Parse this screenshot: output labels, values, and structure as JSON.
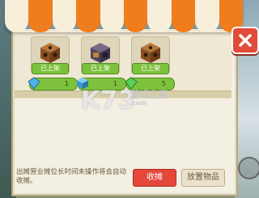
{
  "colors": {
    "awning_orange": "#f07d1c",
    "awning_cream": "#f7efd9",
    "panel": "#f3efe2",
    "badge_green": "#7cc13b",
    "collect_red": "#e5473b",
    "close_red": "#e24a3a"
  },
  "shelf": {
    "items": [
      {
        "icon": "crate-block-icon",
        "badge": "已上架",
        "price": "1",
        "price_icon": "blue-gem-icon"
      },
      {
        "icon": "furnace-block-icon",
        "badge": "已上架",
        "price": "1",
        "price_icon": "blue-cube-icon"
      },
      {
        "icon": "crate-block-icon",
        "badge": "已上架",
        "price": "5",
        "price_icon": "green-gem-icon"
      }
    ]
  },
  "footer": {
    "notice": "出摊营业摊位长时间未操作将会自动收摊。",
    "collect_label": "收摊",
    "place_label": "放置物品"
  },
  "watermark": {
    "logo": "K73",
    "cn": "游戏之家",
    "url": ".com"
  }
}
